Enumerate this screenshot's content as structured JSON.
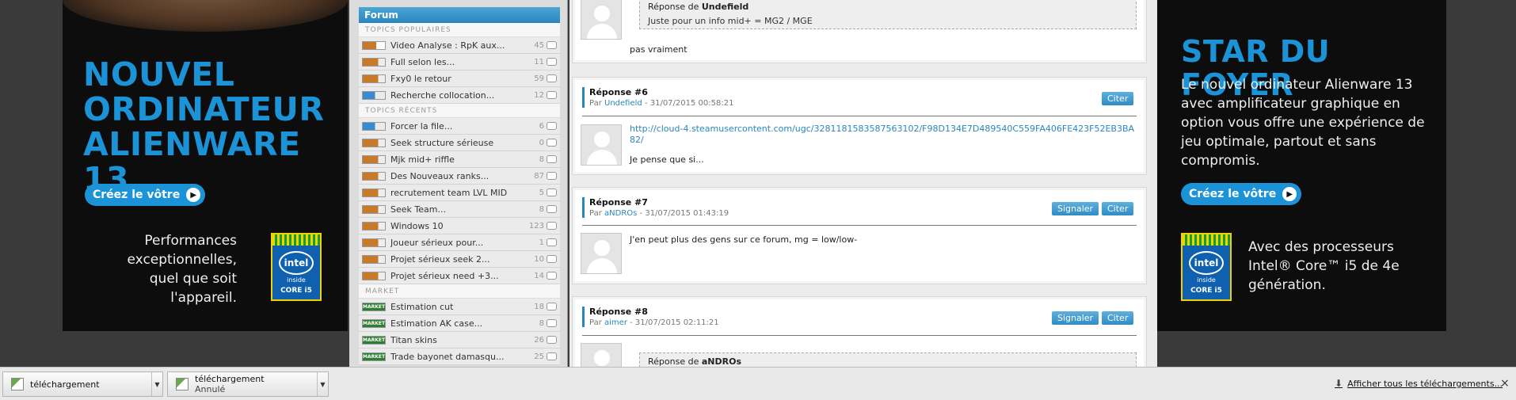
{
  "ad_left": {
    "headline": "NOUVEL ORDINATEUR ALIENWARE 13",
    "cta": "Créez le vôtre",
    "performance": "Performances exceptionnelles, quel que soit l'appareil.",
    "intel_brand": "intel",
    "intel_inside": "inside",
    "intel_core": "CORE i5"
  },
  "ad_right": {
    "headline": "STAR DU FOYER",
    "body": "Le nouvel ordinateur Alienware 13 avec amplificateur graphique en option vous offre une expérience de jeu optimale, partout et sans compromis.",
    "cta": "Créez le vôtre",
    "performance": "Avec des processeurs Intel® Core™ i5 de 4e génération.",
    "intel_brand": "intel",
    "intel_inside": "inside",
    "intel_core": "CORE i5"
  },
  "sidebar": {
    "title": "Forum",
    "sections": [
      {
        "label": "TOPICS POPULAIRES",
        "items": [
          {
            "icon": "youtube",
            "title": "Video Analyse : RpK aux...",
            "count": "45"
          },
          {
            "icon": "tv",
            "title": "Full selon les...",
            "count": "11"
          },
          {
            "icon": "tv",
            "title": "Fxy0 le retour",
            "count": "59"
          },
          {
            "icon": "commerce",
            "title": "Recherche collocation...",
            "count": "12"
          }
        ]
      },
      {
        "label": "TOPICS RÉCENTS",
        "items": [
          {
            "icon": "commerce",
            "title": "Forcer la file...",
            "count": "6"
          },
          {
            "icon": "tv",
            "title": "Seek structure sérieuse",
            "count": "0"
          },
          {
            "icon": "tv",
            "title": "Mjk mid+ riffle",
            "count": "8"
          },
          {
            "icon": "tv",
            "title": "Des Nouveaux ranks...",
            "count": "87"
          },
          {
            "icon": "tv",
            "title": "recrutement team LVL MID",
            "count": "5"
          },
          {
            "icon": "tv",
            "title": "Seek Team...",
            "count": "8"
          },
          {
            "icon": "tv",
            "title": "Windows 10",
            "count": "123"
          },
          {
            "icon": "tv",
            "title": "Joueur sérieux pour...",
            "count": "1"
          },
          {
            "icon": "tv",
            "title": "Projet sérieux seek 2...",
            "count": "10"
          },
          {
            "icon": "tv",
            "title": "Projet sérieux need +3...",
            "count": "14"
          }
        ]
      },
      {
        "label": "MARKET",
        "items": [
          {
            "icon": "market",
            "title": "Estimation cut",
            "count": "18"
          },
          {
            "icon": "market",
            "title": "Estimation AK case...",
            "count": "8"
          },
          {
            "icon": "market",
            "title": "Titan skins",
            "count": "26"
          },
          {
            "icon": "market",
            "title": "Trade bayonet damasqu...",
            "count": "25"
          }
        ]
      }
    ],
    "market_icon_text": "MARKET"
  },
  "posts": {
    "top": {
      "quote_prefix": "Réponse de",
      "quote_author": "Undefield",
      "quote_text": "Juste pour un info mid+ = MG2 / MGE",
      "text": "pas vraiment"
    },
    "p6": {
      "title": "Réponse #6",
      "by": "Par",
      "author": "Undefield",
      "date": "- 31/07/2015 00:58:21",
      "link": "http://cloud-4.steamusercontent.com/ugc/3281181583587563102/F98D134E7D489540C559FA406FE423F52EB3BA82/",
      "text": "Je pense que si...",
      "cite": "Citer"
    },
    "p7": {
      "title": "Réponse #7",
      "by": "Par",
      "author": "aNDROs",
      "date": "- 31/07/2015 01:43:19",
      "text": "J'en peut plus des gens sur ce forum, mg = low/low-",
      "report": "Signaler",
      "cite": "Citer"
    },
    "p8": {
      "title": "Réponse #8",
      "by": "Par",
      "author": "aimer",
      "date": "- 31/07/2015 02:11:21",
      "quote_prefix": "Réponse de",
      "quote_author": "aNDROs",
      "report": "Signaler",
      "cite": "Citer"
    }
  },
  "downloads": {
    "items": [
      {
        "name": "téléchargement",
        "status": ""
      },
      {
        "name": "téléchargement",
        "status": "Annulé"
      }
    ],
    "show_all": "Afficher tous les téléchargements...",
    "close": "×"
  },
  "colors": {
    "accent": "#2a86be",
    "ad_blue": "#1b93d6",
    "market_green": "#2e7d32"
  }
}
